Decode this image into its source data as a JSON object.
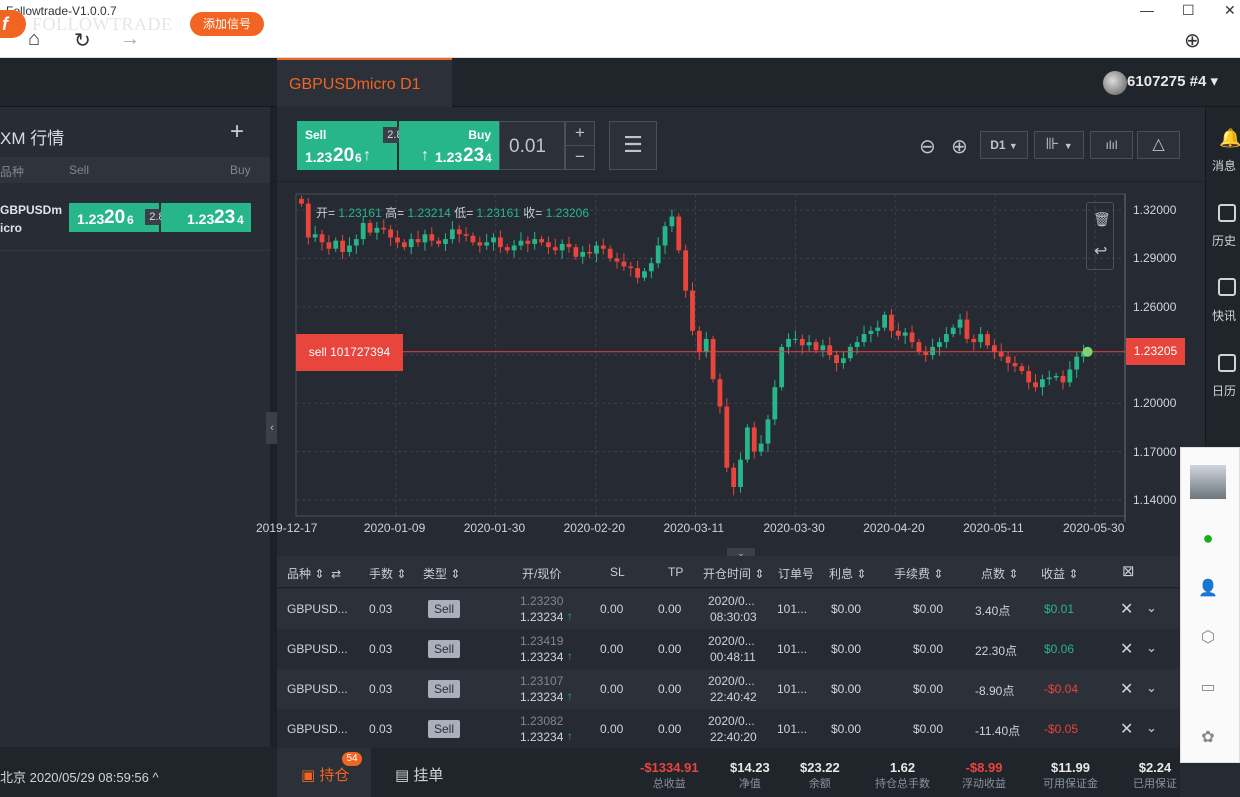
{
  "window": {
    "title": "Followtrade-V1.0.0.7"
  },
  "header": {
    "logo_text": "FOLLOWTRADE",
    "logo_mark": "f",
    "add_signal": "添加信号",
    "symbol_tab": "GBPUSDmicro D1",
    "account": "6107275 #4 ▾"
  },
  "watchlist": {
    "title": "XM 行情",
    "col_symbol": "品种",
    "col_sell": "Sell",
    "col_buy": "Buy",
    "rows": [
      {
        "symbol_line1": "GBPUSDm",
        "symbol_line2": "icro",
        "sell_main": "1.23",
        "sell_big": "20",
        "sell_small": "6",
        "spread": "2.80",
        "buy_main": "1.23",
        "buy_big": "23",
        "buy_small": "4"
      }
    ],
    "clock": "北京 2020/05/29 08:59:56 ^"
  },
  "trade_panel": {
    "sell_label": "Sell",
    "sell_main": "1.23",
    "sell_big": "20",
    "sell_small": "6",
    "sell_arrow": "↑",
    "spread": "2.80",
    "buy_label": "Buy",
    "buy_main": "1.23",
    "buy_big": "23",
    "buy_small": "4",
    "buy_arrow": "↑",
    "lot": "0.01",
    "plus": "+",
    "minus": "−",
    "timeframe": "D1"
  },
  "chart_data": {
    "type": "candlestick",
    "ohlc_label": {
      "open_l": "开=",
      "open": "1.23161",
      "high_l": "高=",
      "high": "1.23214",
      "low_l": "低=",
      "low": "1.23161",
      "close_l": "收=",
      "close": "1.23206"
    },
    "y_ticks": [
      "1.32000",
      "1.29000",
      "1.26000",
      "1.23000",
      "1.20000",
      "1.17000",
      "1.14000"
    ],
    "y_tick_values": [
      1.32,
      1.29,
      1.26,
      1.23,
      1.2,
      1.17,
      1.14
    ],
    "x_ticks": [
      "2019-12-17",
      "2020-01-09",
      "2020-01-30",
      "2020-02-20",
      "2020-03-11",
      "2020-03-30",
      "2020-04-20",
      "2020-05-11",
      "2020-05-30"
    ],
    "ylim": [
      1.13,
      1.33
    ],
    "current_price": "1.23205",
    "current_price_value": 1.23205,
    "order_line_label": "sell 101727394",
    "closes": [
      1.324,
      1.303,
      1.305,
      1.3,
      1.296,
      1.301,
      1.294,
      1.298,
      1.302,
      1.312,
      1.306,
      1.309,
      1.308,
      1.303,
      1.3,
      1.297,
      1.302,
      1.3,
      1.305,
      1.301,
      1.299,
      1.302,
      1.308,
      1.305,
      1.304,
      1.3,
      1.298,
      1.3,
      1.303,
      1.297,
      1.295,
      1.298,
      1.301,
      1.299,
      1.302,
      1.3,
      1.297,
      1.295,
      1.299,
      1.297,
      1.291,
      1.294,
      1.293,
      1.298,
      1.296,
      1.29,
      1.288,
      1.285,
      1.284,
      1.278,
      1.282,
      1.287,
      1.298,
      1.31,
      1.316,
      1.295,
      1.27,
      1.245,
      1.232,
      1.24,
      1.215,
      1.198,
      1.16,
      1.148,
      1.165,
      1.185,
      1.17,
      1.175,
      1.19,
      1.21,
      1.235,
      1.24,
      1.24,
      1.236,
      1.238,
      1.233,
      1.236,
      1.23,
      1.225,
      1.228,
      1.235,
      1.238,
      1.243,
      1.245,
      1.247,
      1.255,
      1.245,
      1.242,
      1.244,
      1.238,
      1.232,
      1.23,
      1.235,
      1.238,
      1.243,
      1.247,
      1.252,
      1.24,
      1.238,
      1.243,
      1.236,
      1.232,
      1.229,
      1.225,
      1.223,
      1.22,
      1.213,
      1.21,
      1.215,
      1.216,
      1.217,
      1.213,
      1.221,
      1.229,
      1.232
    ],
    "date_start_label": "2019-12-17"
  },
  "table": {
    "headers": [
      "品种",
      "手数",
      "类型",
      "开/现价",
      "SL",
      "TP",
      "开仓时间",
      "订单号",
      "利息",
      "手续费",
      "点数",
      "收益"
    ],
    "rows": [
      {
        "symbol": "GBPUSD...",
        "lots": "0.03",
        "type": "Sell",
        "open": "1.23230",
        "current": "1.23234",
        "arrow": "↑",
        "sl": "0.00",
        "tp": "0.00",
        "date": "2020/0...",
        "time": "08:30:03",
        "order": "101...",
        "swap": "$0.00",
        "fee": "$0.00",
        "points": "3.40点",
        "profit": "$0.01",
        "profit_sign": "pos"
      },
      {
        "symbol": "GBPUSD...",
        "lots": "0.03",
        "type": "Sell",
        "open": "1.23419",
        "current": "1.23234",
        "arrow": "↑",
        "sl": "0.00",
        "tp": "0.00",
        "date": "2020/0...",
        "time": "00:48:11",
        "order": "101...",
        "swap": "$0.00",
        "fee": "$0.00",
        "points": "22.30点",
        "profit": "$0.06",
        "profit_sign": "pos"
      },
      {
        "symbol": "GBPUSD...",
        "lots": "0.03",
        "type": "Sell",
        "open": "1.23107",
        "current": "1.23234",
        "arrow": "↑",
        "sl": "0.00",
        "tp": "0.00",
        "date": "2020/0...",
        "time": "22:40:42",
        "order": "101...",
        "swap": "$0.00",
        "fee": "$0.00",
        "points": "-8.90点",
        "profit": "-$0.04",
        "profit_sign": "neg"
      },
      {
        "symbol": "GBPUSD...",
        "lots": "0.03",
        "type": "Sell",
        "open": "1.23082",
        "current": "1.23234",
        "arrow": "↑",
        "sl": "0.00",
        "tp": "0.00",
        "date": "2020/0...",
        "time": "22:40:20",
        "order": "101...",
        "swap": "$0.00",
        "fee": "$0.00",
        "points": "-11.40点",
        "profit": "-$0.05",
        "profit_sign": "neg"
      }
    ]
  },
  "bottom": {
    "tab_holding": "持仓",
    "holding_count": "54",
    "tab_pending": "挂单",
    "summary": [
      {
        "value": "-$1334.91",
        "label": "总收益",
        "sign": "neg"
      },
      {
        "value": "$14.23",
        "label": "净值",
        "sign": ""
      },
      {
        "value": "$23.22",
        "label": "余额",
        "sign": ""
      },
      {
        "value": "1.62",
        "label": "持仓总手数",
        "sign": ""
      },
      {
        "value": "-$8.99",
        "label": "浮动收益",
        "sign": "neg"
      },
      {
        "value": "$11.99",
        "label": "可用保证金",
        "sign": ""
      },
      {
        "value": "$2.24",
        "label": "已用保证",
        "sign": ""
      }
    ]
  },
  "right_sidebar": {
    "items": [
      "消息",
      "历史",
      "快讯",
      "日历"
    ]
  },
  "colors": {
    "accent": "#f26422",
    "up": "#27b58a",
    "down": "#e8453c"
  }
}
